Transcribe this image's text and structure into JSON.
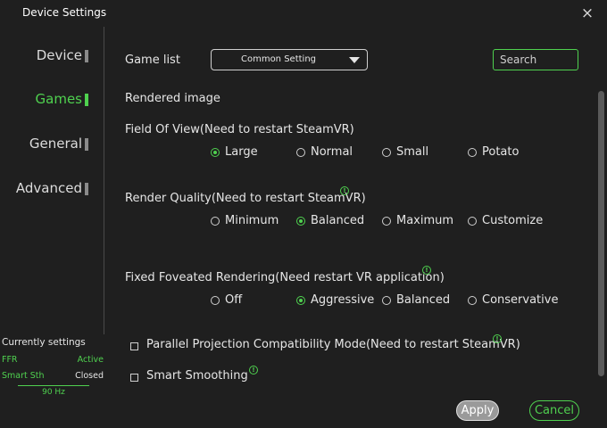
{
  "window": {
    "title": "Device Settings",
    "close_icon": "×"
  },
  "sidebar": {
    "items": [
      {
        "label": "Device",
        "active": false
      },
      {
        "label": "Games",
        "active": true
      },
      {
        "label": "General",
        "active": false
      },
      {
        "label": "Advanced",
        "active": false
      }
    ]
  },
  "current_settings": {
    "title": "Currently settings",
    "rows": [
      {
        "key": "FFR",
        "value": "Active",
        "value_color": "#4fd14f"
      },
      {
        "key": "Smart Sth",
        "value": "Closed",
        "value_color": "#e6e6e6"
      }
    ],
    "hz": "90 Hz"
  },
  "main": {
    "game_list_label": "Game list",
    "game_list_value": "Common Setting",
    "search_placeholder": "Search",
    "rendered_image_label": "Rendered image",
    "fov": {
      "label": "Field Of View(Need to restart SteamVR)",
      "options": [
        "Large",
        "Normal",
        "Small",
        "Potato"
      ],
      "selected": "Large"
    },
    "render_quality": {
      "label": "Render Quality(Need to restart SteamVR)",
      "options": [
        "Minimum",
        "Balanced",
        "Maximum",
        "Customize"
      ],
      "selected": "Balanced"
    },
    "ffr": {
      "label": "Fixed Foveated Rendering(Need restart VR application)",
      "options": [
        "Off",
        "Aggressive",
        "Balanced",
        "Conservative"
      ],
      "selected": "Aggressive"
    },
    "parallel_projection": {
      "label": "Parallel Projection Compatibility Mode(Need to restart SteamVR)",
      "checked": false
    },
    "smart_smoothing": {
      "label": "Smart Smoothing",
      "checked": false
    }
  },
  "footer": {
    "apply_label": "Apply",
    "cancel_label": "Cancel"
  },
  "colors": {
    "accent": "#4fd14f",
    "background": "#1f1f1f",
    "text": "#e6e6e6"
  },
  "icons": {
    "info": "!"
  }
}
